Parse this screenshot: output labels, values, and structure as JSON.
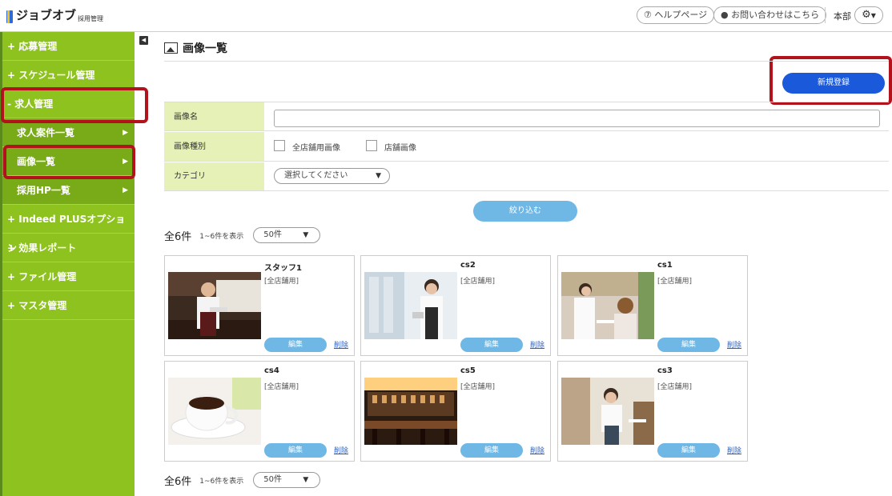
{
  "header": {
    "logo_text": "ジョブオブ",
    "logo_sub": "採用管理",
    "help": "⑦ ヘルプページ",
    "contact": "● お問い合わせはこちら",
    "branch": "本部",
    "settings_icon": "gear-icon"
  },
  "sidebar": {
    "items": [
      {
        "label": "+ 応募管理"
      },
      {
        "label": "+ スケジュール管理"
      },
      {
        "label": "- 求人管理"
      },
      {
        "label": "求人案件一覧",
        "sub": true
      },
      {
        "label": "画像一覧",
        "sub": true
      },
      {
        "label": "採用HP一覧",
        "sub": true
      },
      {
        "label": "+ Indeed PLUSオプション"
      },
      {
        "label": "+ 効果レポート"
      },
      {
        "label": "+ ファイル管理"
      },
      {
        "label": "+ マスタ管理"
      }
    ],
    "arrow": "▶"
  },
  "page": {
    "title": "画像一覧",
    "new_button": "新規登録"
  },
  "filters": {
    "name_label": "画像名",
    "name_value": "",
    "type_label": "画像種別",
    "type_option1": "全店舗用画像",
    "type_option2": "店舗画像",
    "category_label": "カテゴリ",
    "category_value": "選択してください",
    "submit": "絞り込む"
  },
  "summary": {
    "total": "全6件",
    "range": "1~6件を表示",
    "per_page": "50件",
    "arrow": "▼"
  },
  "cards": [
    {
      "title": "スタッフ1",
      "tag": "[全店舗用]",
      "edit": "編集",
      "delete": "削除",
      "scene": "staff-at-bar"
    },
    {
      "title": "cs2",
      "tag": "[全店舗用]",
      "edit": "編集",
      "delete": "削除",
      "scene": "waitress-bright"
    },
    {
      "title": "cs1",
      "tag": "[全店舗用]",
      "edit": "編集",
      "delete": "削除",
      "scene": "cafe-customers"
    },
    {
      "title": "cs4",
      "tag": "[全店舗用]",
      "edit": "編集",
      "delete": "削除",
      "scene": "coffee-cup"
    },
    {
      "title": "cs5",
      "tag": "[全店舗用]",
      "edit": "編集",
      "delete": "削除",
      "scene": "bar-interior"
    },
    {
      "title": "cs3",
      "tag": "[全店舗用]",
      "edit": "編集",
      "delete": "削除",
      "scene": "waitress-cafe"
    }
  ],
  "colors": {
    "sidebar": "#8dc21f",
    "highlight": "#b1121b",
    "primary_button": "#1a59d9",
    "secondary_button": "#6fb7e4",
    "filter_label_bg": "#e5f1b6"
  }
}
